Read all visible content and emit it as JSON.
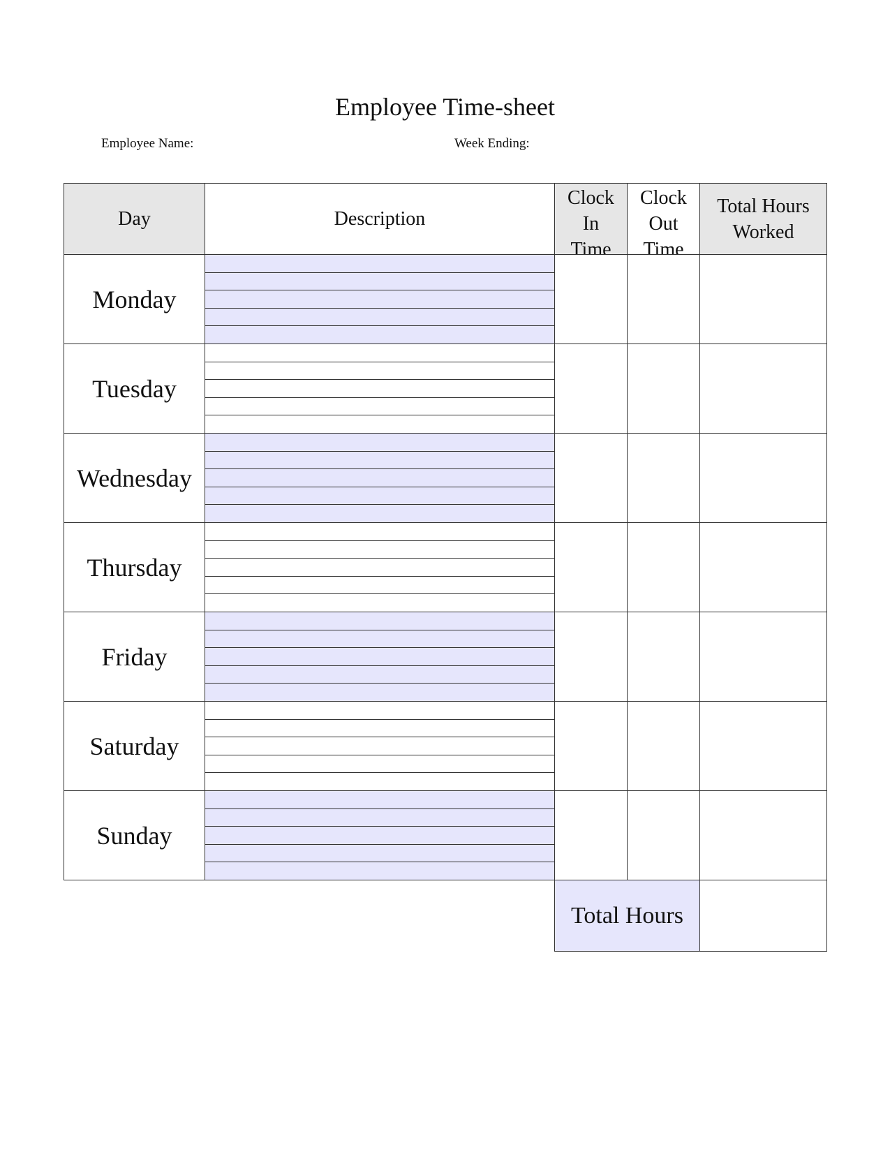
{
  "document": {
    "title": "Employee Time-sheet",
    "employee_name_label": "Employee Name:",
    "week_ending_label": "Week Ending:"
  },
  "table": {
    "headers": {
      "day": "Day",
      "description": "Description",
      "clock_in": [
        "Clock",
        "In",
        "Time"
      ],
      "clock_out": [
        "Clock",
        "Out",
        "Time"
      ],
      "total_hours_worked": [
        "Total Hours",
        "Worked"
      ]
    },
    "days": [
      {
        "name": "Monday",
        "shaded": true
      },
      {
        "name": "Tuesday",
        "shaded": false
      },
      {
        "name": "Wednesday",
        "shaded": true
      },
      {
        "name": "Thursday",
        "shaded": false
      },
      {
        "name": "Friday",
        "shaded": true
      },
      {
        "name": "Saturday",
        "shaded": false
      },
      {
        "name": "Sunday",
        "shaded": true
      }
    ],
    "description_lines_per_day": 5,
    "total_hours_label": "Total Hours"
  },
  "colors": {
    "header_gray": "#e6e6e6",
    "row_shade": "#e6e6fc",
    "border": "#333333"
  }
}
